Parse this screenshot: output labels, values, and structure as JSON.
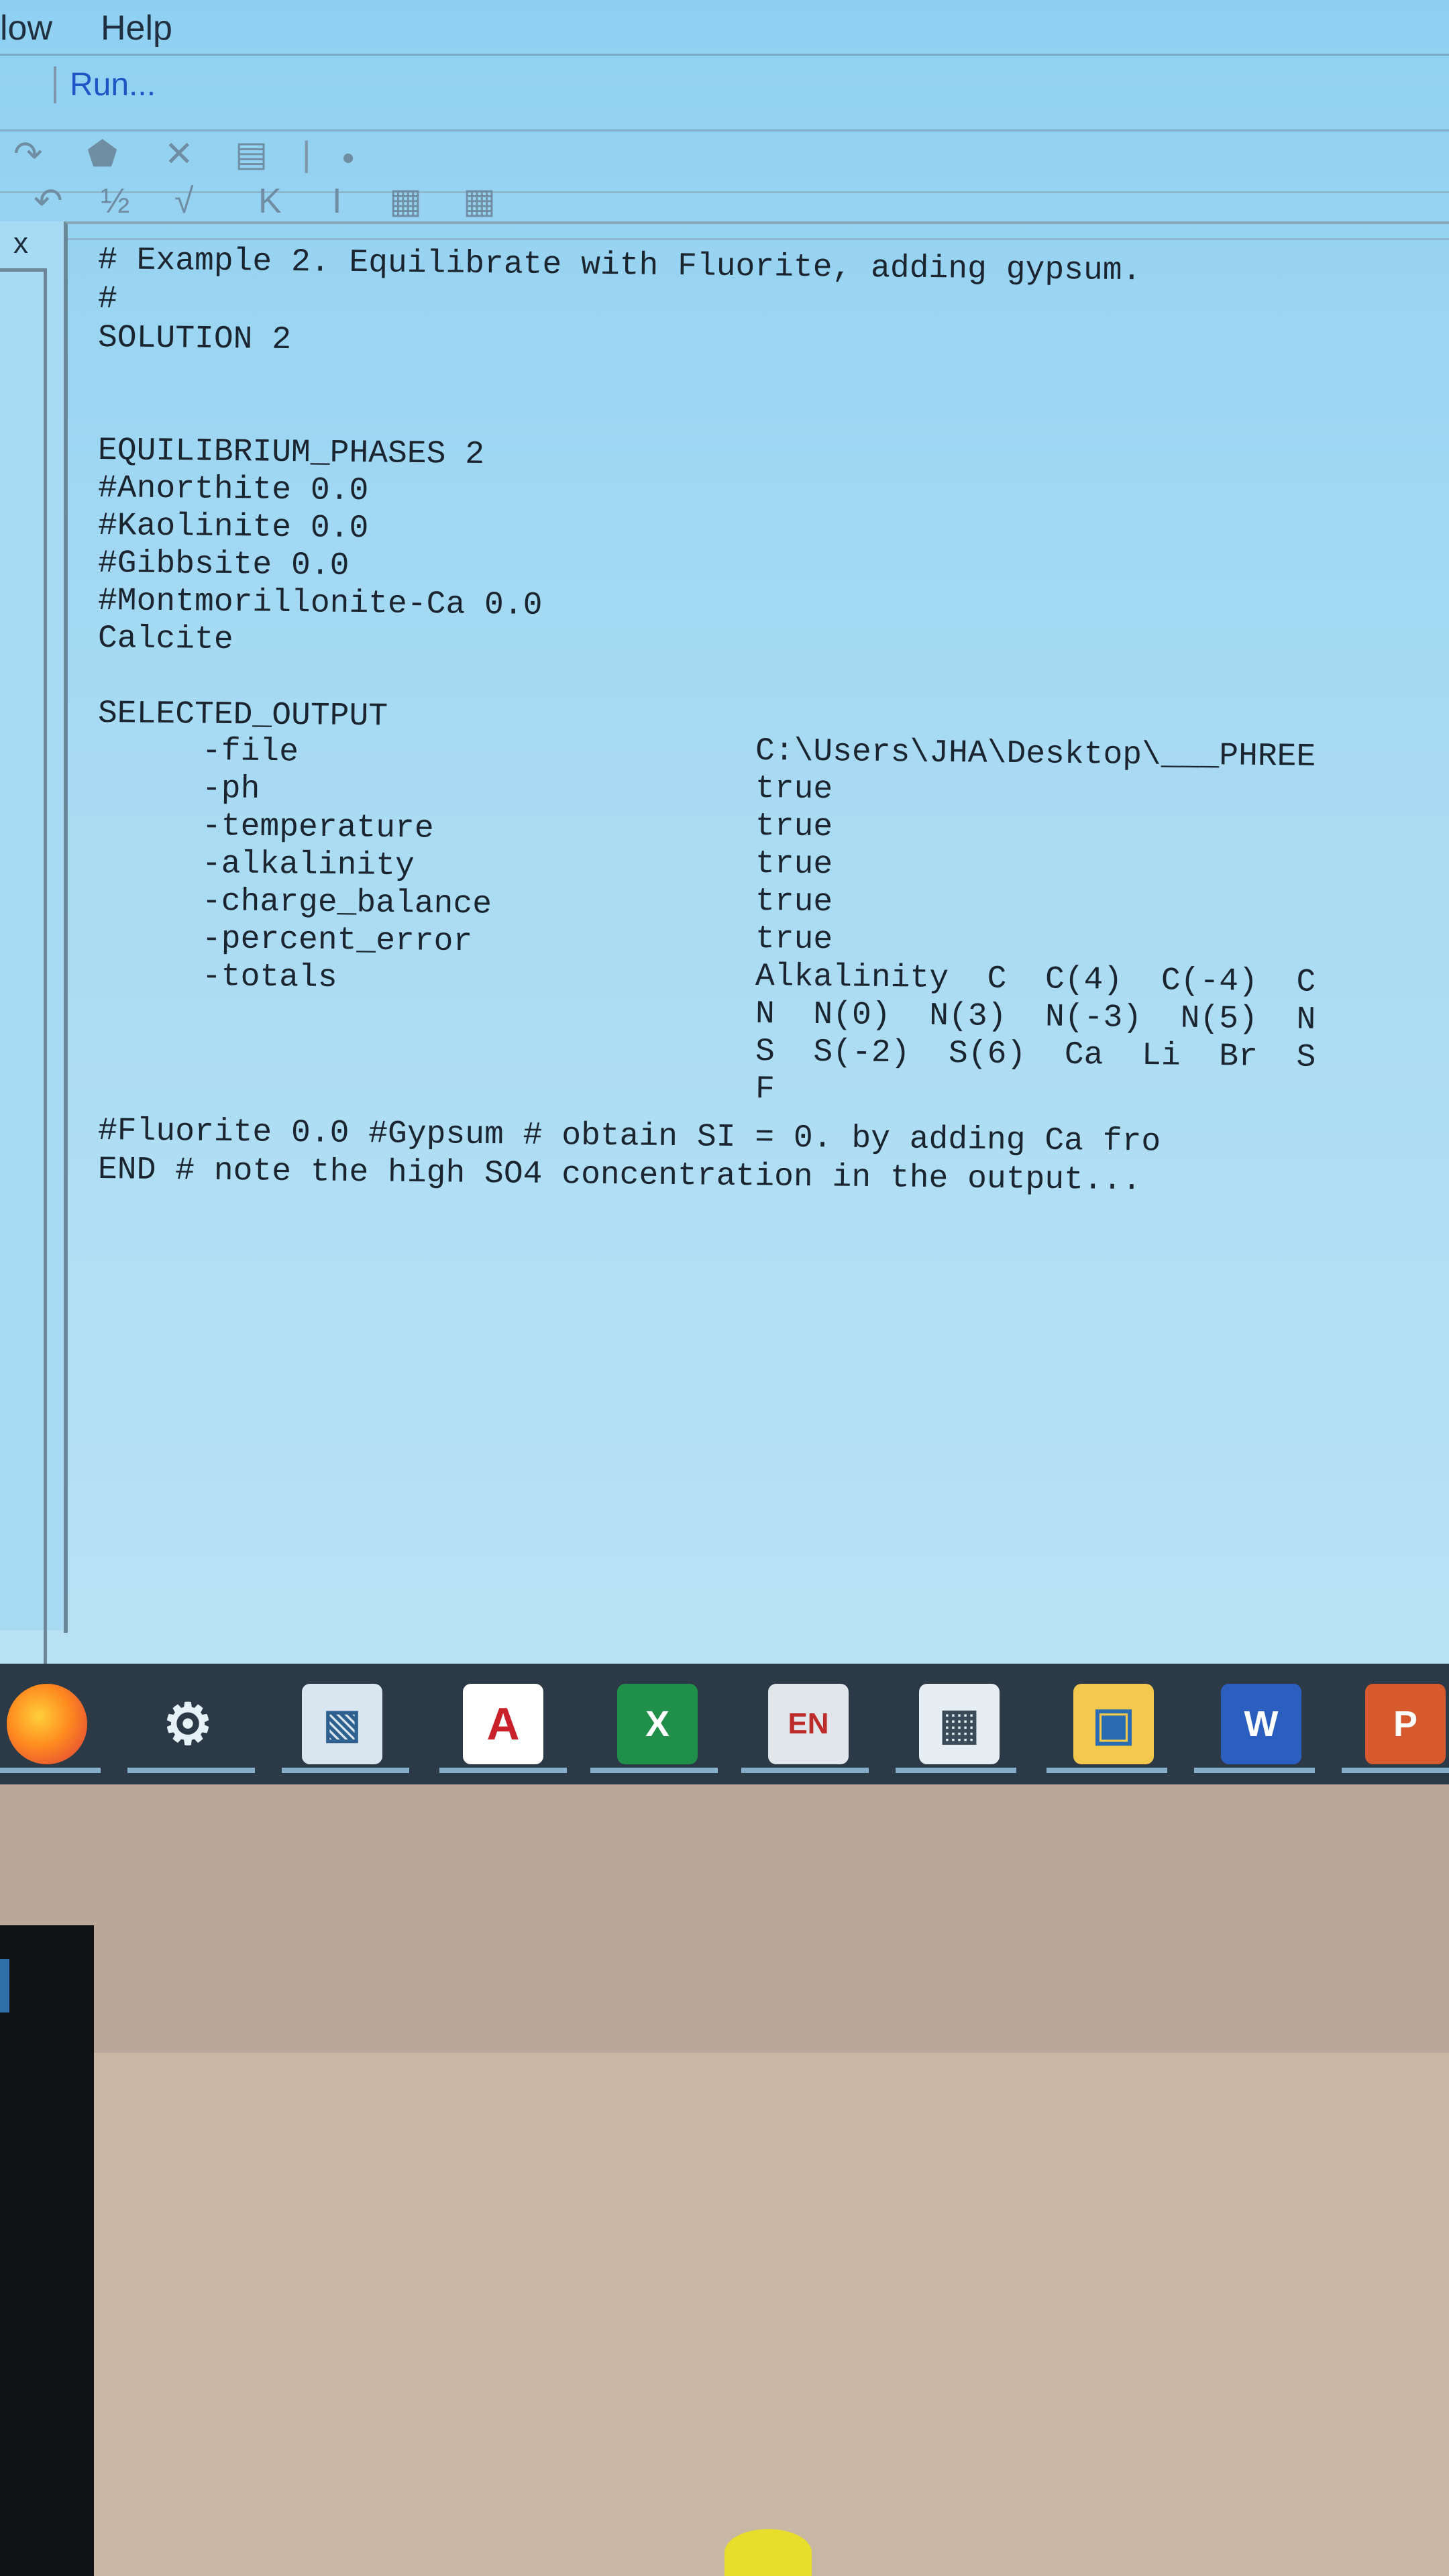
{
  "menubar": {
    "items": [
      "low",
      "Help"
    ]
  },
  "run_label": "Run...",
  "toolbar": {
    "row1_icons": [
      "redo-icon",
      "select-icon",
      "delete-icon",
      "format-icon",
      "bullet-icon"
    ],
    "row2_icons": [
      "undo-icon",
      "fraction-icon",
      "sqrt-icon",
      "K",
      "I",
      "table-icon",
      "table2-icon"
    ]
  },
  "toolbar_row2_texts": [
    "K",
    "I"
  ],
  "left_pane": {
    "close_label": "x"
  },
  "editor": {
    "lines": [
      "# Example 2. Equilibrate with Fluorite, adding gypsum.",
      "#",
      "SOLUTION 2",
      "EQUILIBRIUM_PHASES 2",
      "#Anorthite 0.0",
      "#Kaolinite 0.0",
      "#Gibbsite 0.0",
      "#Montmorillonite-Ca 0.0",
      "Calcite",
      "SELECTED_OUTPUT",
      "-file",
      "-ph",
      "-temperature",
      "-alkalinity",
      "-charge_balance",
      "-percent_error",
      "-totals",
      "#Fluorite 0.0 #Gypsum # obtain SI = 0. by adding Ca fro",
      "END # note the high SO4 concentration in the output..."
    ],
    "values": [
      "C:\\Users\\JHA\\Desktop\\___PHREE",
      "true",
      "true",
      "true",
      "true",
      "true",
      "Alkalinity  C  C(4)  C(-4)  C",
      "N  N(0)  N(3)  N(-3)  N(5)  N",
      "S  S(-2)  S(6)  Ca  Li  Br  S",
      "F"
    ]
  },
  "taskbar": {
    "apps": [
      "firefox",
      "settings",
      "photos",
      "acrobat",
      "excel",
      "language",
      "calculator",
      "explorer",
      "word",
      "powerpoint"
    ],
    "labels": {
      "excel": "X",
      "language": "EN",
      "word": "W",
      "powerpoint": "P"
    }
  }
}
